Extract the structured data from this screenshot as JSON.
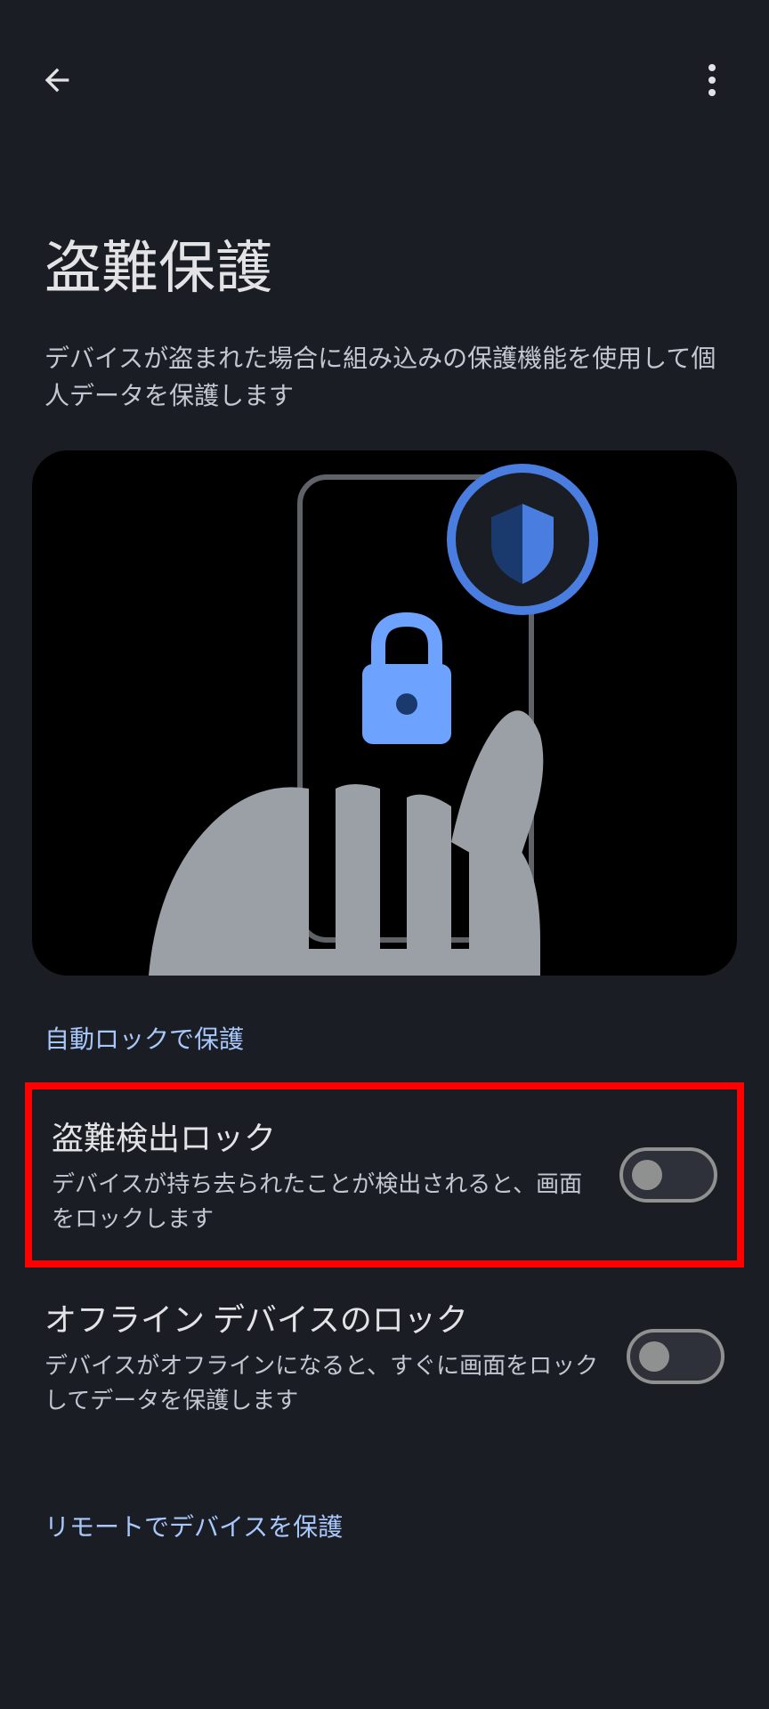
{
  "page": {
    "title": "盗難保護",
    "subtitle": "デバイスが盗まれた場合に組み込みの保護機能を使用して個人データを保護します"
  },
  "sections": {
    "auto_lock": {
      "label": "自動ロックで保護"
    },
    "remote": {
      "label": "リモートでデバイスを保護"
    }
  },
  "settings": {
    "theft_detection": {
      "title": "盗難検出ロック",
      "description": "デバイスが持ち去られたことが検出されると、画面をロックします",
      "enabled": false,
      "highlighted": true
    },
    "offline_lock": {
      "title": "オフライン デバイスのロック",
      "description": "デバイスがオフラインになると、すぐに画面をロックしてデータを保護します",
      "enabled": false
    }
  }
}
